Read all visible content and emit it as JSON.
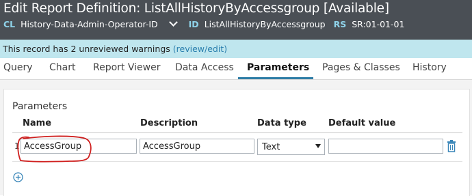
{
  "header": {
    "title": "Edit  Report Definition: ListAllHistoryByAccessgroup [Available]",
    "class_label": "CL",
    "class_value": "History-Data-Admin-Operator-ID",
    "id_label": "ID",
    "id_value": "ListAllHistoryByAccessgroup",
    "rs_label": "RS",
    "rs_value": "SR:01-01-01"
  },
  "warning": {
    "text": "This record has 2 unreviewed warnings",
    "link": "(review/edit)"
  },
  "tabs": [
    {
      "label": "Query"
    },
    {
      "label": "Chart"
    },
    {
      "label": "Report Viewer"
    },
    {
      "label": "Data Access"
    },
    {
      "label": "Parameters",
      "active": true
    },
    {
      "label": "Pages & Classes"
    },
    {
      "label": "History"
    }
  ],
  "parameters": {
    "title": "Parameters",
    "columns": {
      "name": "Name",
      "description": "Description",
      "data_type": "Data type",
      "default_value": "Default value"
    },
    "rows": [
      {
        "index": "1",
        "name": "AccessGroup",
        "description": "AccessGroup",
        "data_type": "Text",
        "default_value": ""
      }
    ]
  },
  "colors": {
    "header_bg": "#4a4f55",
    "label_accent": "#8fd3ea",
    "warning_bg": "#bfe6ee",
    "link": "#2a7fae",
    "active_tab_underline": "#2e7da6",
    "annotation": "#d0201f"
  },
  "icons": {
    "class_dropdown": "chevron-down-icon",
    "select_arrow": "caret-down-icon",
    "delete": "trash-icon",
    "add": "plus-circle-icon"
  }
}
